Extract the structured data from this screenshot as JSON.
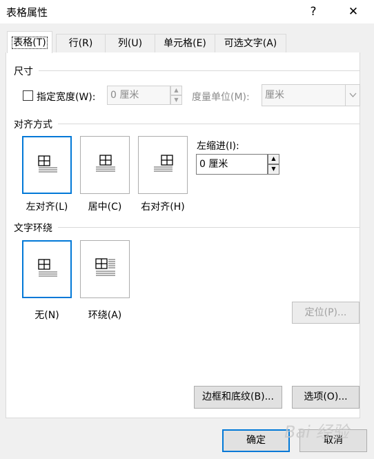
{
  "window": {
    "title": "表格属性",
    "help_glyph": "?",
    "close_glyph": "✕"
  },
  "tabs": [
    {
      "label": "表格(T)",
      "active": true
    },
    {
      "label": "行(R)"
    },
    {
      "label": "列(U)"
    },
    {
      "label": "单元格(E)"
    },
    {
      "label": "可选文字(A)"
    }
  ],
  "size": {
    "section_label": "尺寸",
    "preferred_width_label": "指定宽度(W):",
    "preferred_width_value": "0 厘米",
    "measure_in_label": "度量单位(M):",
    "measure_in_value": "厘米"
  },
  "alignment": {
    "section_label": "对齐方式",
    "options": [
      "左对齐(L)",
      "居中(C)",
      "右对齐(H)"
    ],
    "selected": "左对齐(L)",
    "indent_label": "左缩进(I):",
    "indent_value": "0 厘米"
  },
  "text_wrapping": {
    "section_label": "文字环绕",
    "options": [
      "无(N)",
      "环绕(A)"
    ],
    "selected": "无(N)",
    "positioning_button": "定位(P)..."
  },
  "buttons": {
    "borders_shading": "边框和底纹(B)...",
    "options": "选项(O)...",
    "ok": "确定",
    "cancel": "取消"
  },
  "watermark_text": "Bai 经验",
  "colors": {
    "accent": "#0078d7",
    "panel_border": "#d9d9d9"
  }
}
